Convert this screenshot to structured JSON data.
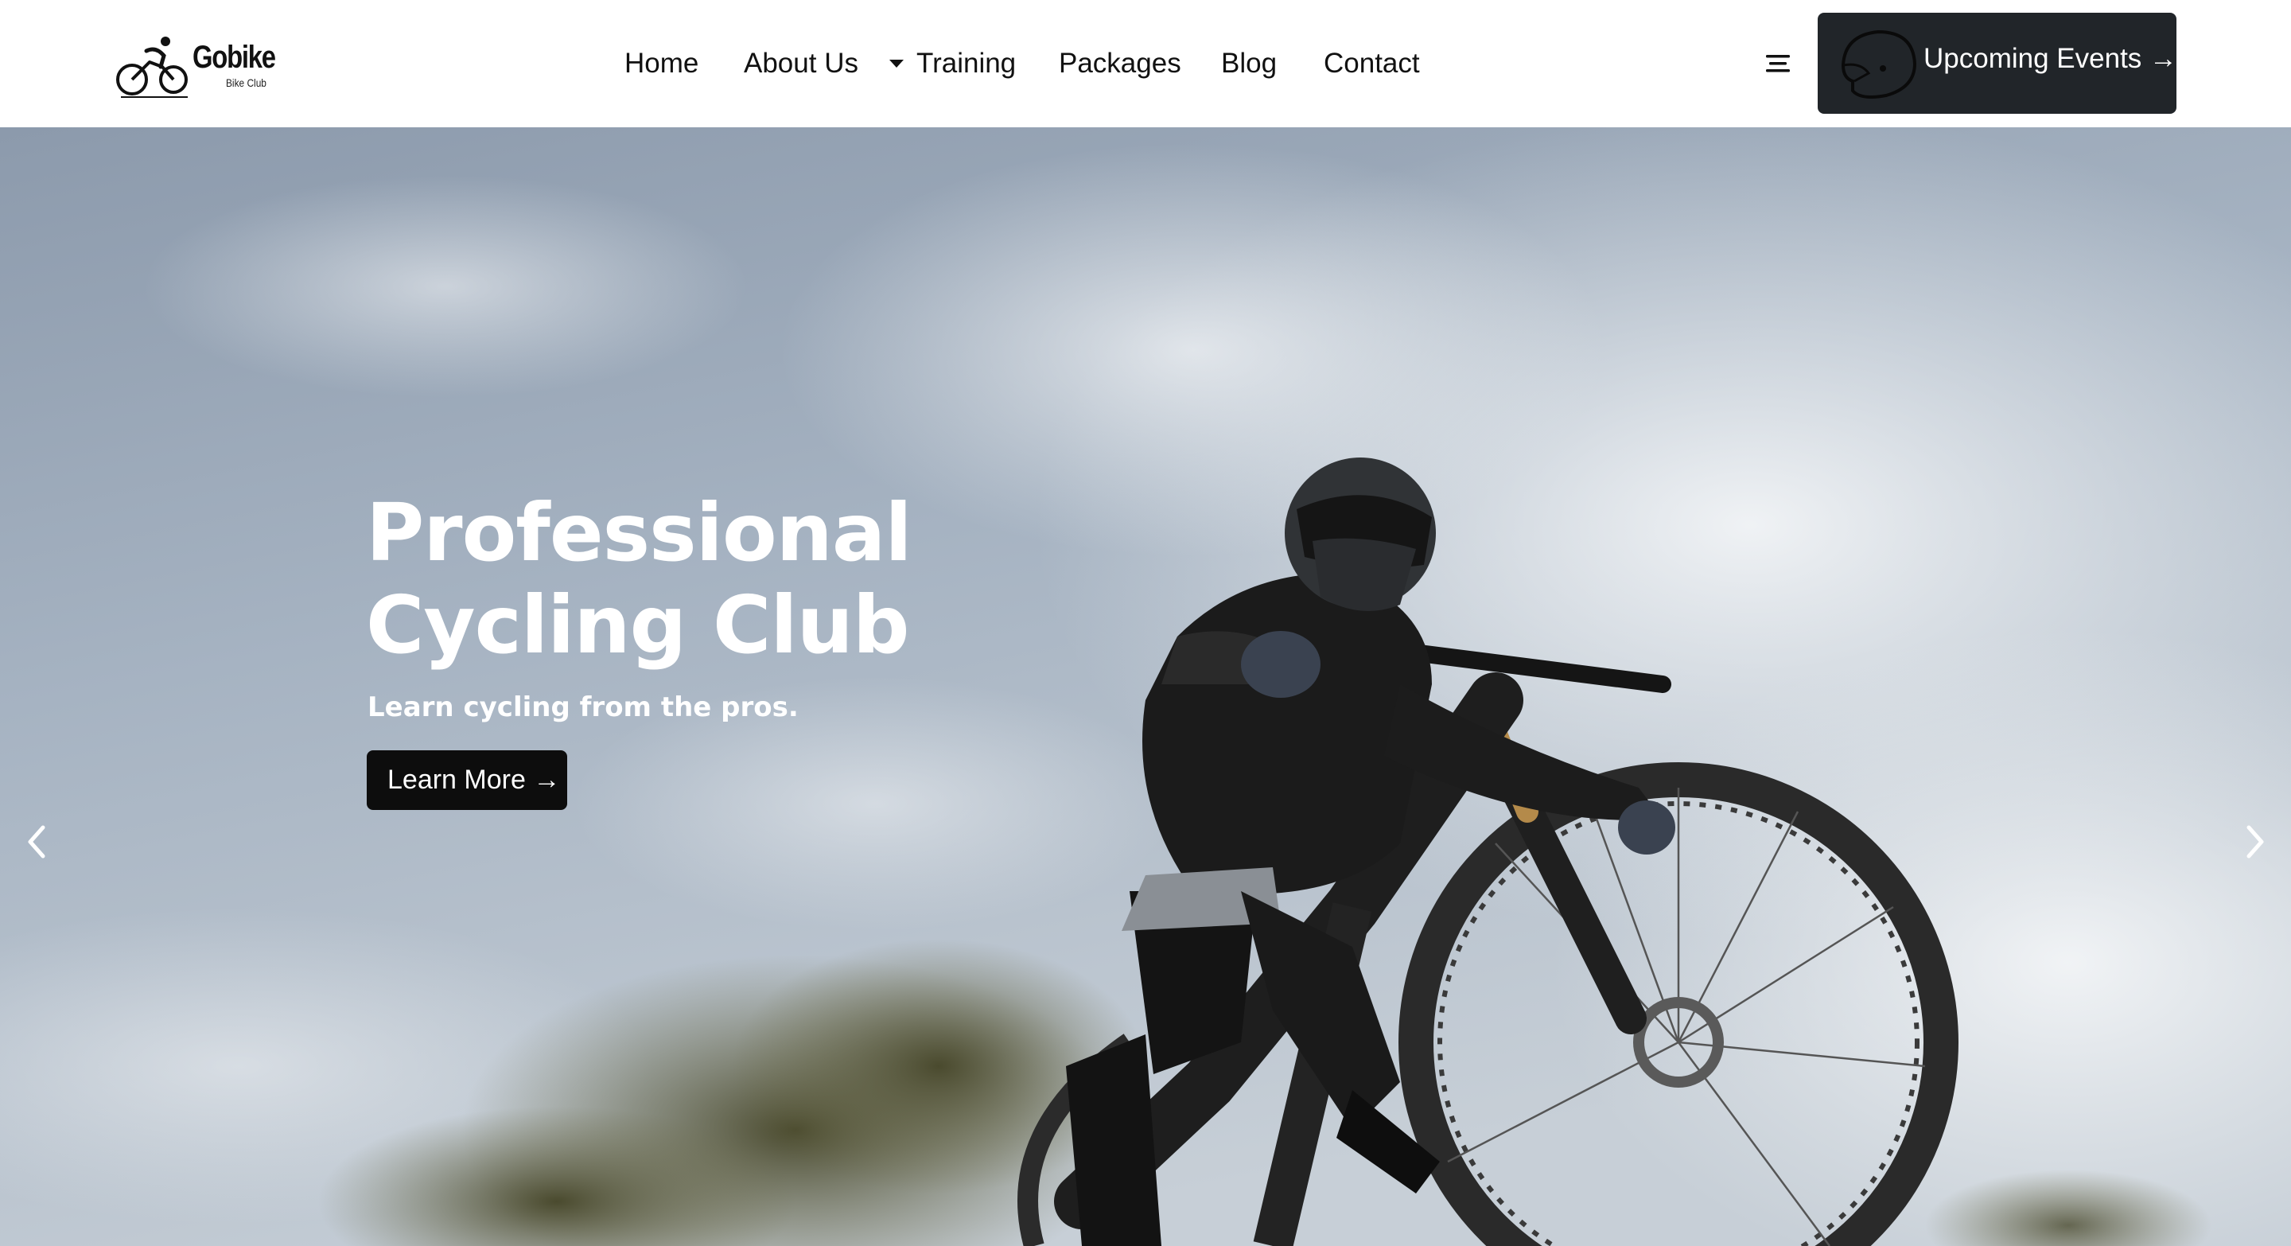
{
  "brand": {
    "name": "Gobike",
    "tagline": "Bike Club"
  },
  "nav": {
    "items": [
      {
        "label": "Home"
      },
      {
        "label": "About Us"
      },
      {
        "label": "Training"
      },
      {
        "label": "Packages"
      },
      {
        "label": "Blog"
      },
      {
        "label": "Contact"
      }
    ],
    "dropdown_icon": "caret-down-icon"
  },
  "header_actions": {
    "menu_icon": "hamburger-menu-icon",
    "events_button": {
      "label": "Upcoming Events →",
      "icon": "helmet-icon"
    }
  },
  "hero": {
    "title_line1": "Professional",
    "title_line2": "Cycling Club",
    "subtitle": "Learn cycling from the pros.",
    "cta_label": "Learn More →",
    "prev_icon": "chevron-left-icon",
    "next_icon": "chevron-right-icon"
  },
  "colors": {
    "dark_button": "#212529",
    "cta_button": "#0d0d0d",
    "text": "#111111",
    "hero_text": "#ffffff"
  }
}
